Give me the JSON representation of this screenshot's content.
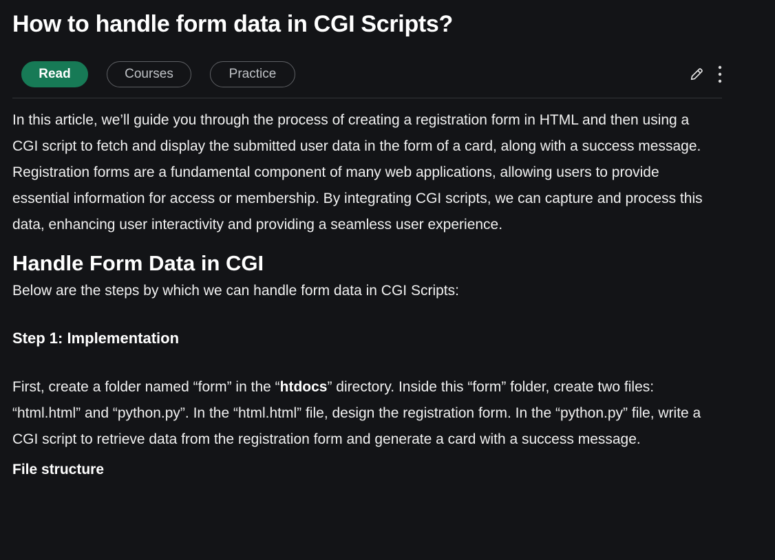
{
  "article": {
    "title": "How to handle form data in CGI Scripts?"
  },
  "tabs": {
    "read": "Read",
    "courses": "Courses",
    "practice": "Practice"
  },
  "icons": {
    "edit": "pencil-icon",
    "more": "kebab-menu-icon"
  },
  "colors": {
    "background": "#131417",
    "accent_green": "#177a56",
    "text": "#f1f1f1"
  },
  "intro": "In this article, we’ll guide you through the process of creating a registration form in HTML and then using a CGI script to fetch and display the submitted user data in the form of a card, along with a success message. Registration forms are a fundamental component of many web applications, allowing users to provide essential information for access or membership. By integrating CGI scripts, we can capture and process this data, enhancing user interactivity and providing a seamless user experience.",
  "section": {
    "heading": "Handle Form Data in CGI",
    "lead": "Below are the steps by which we can handle form data in CGI Scripts:"
  },
  "step1": {
    "heading": "Step 1: Implementation",
    "body_part1": "First, create a folder named “form” in the “",
    "body_bold": "htdocs",
    "body_part2": "” directory. Inside this “form” folder, create two files: “html.html” and “python.py”. In the “html.html” file, design the registration form. In the “python.py” file, write a CGI script to retrieve data from the registration form and generate a card with a success message."
  },
  "file_structure": "File structure"
}
